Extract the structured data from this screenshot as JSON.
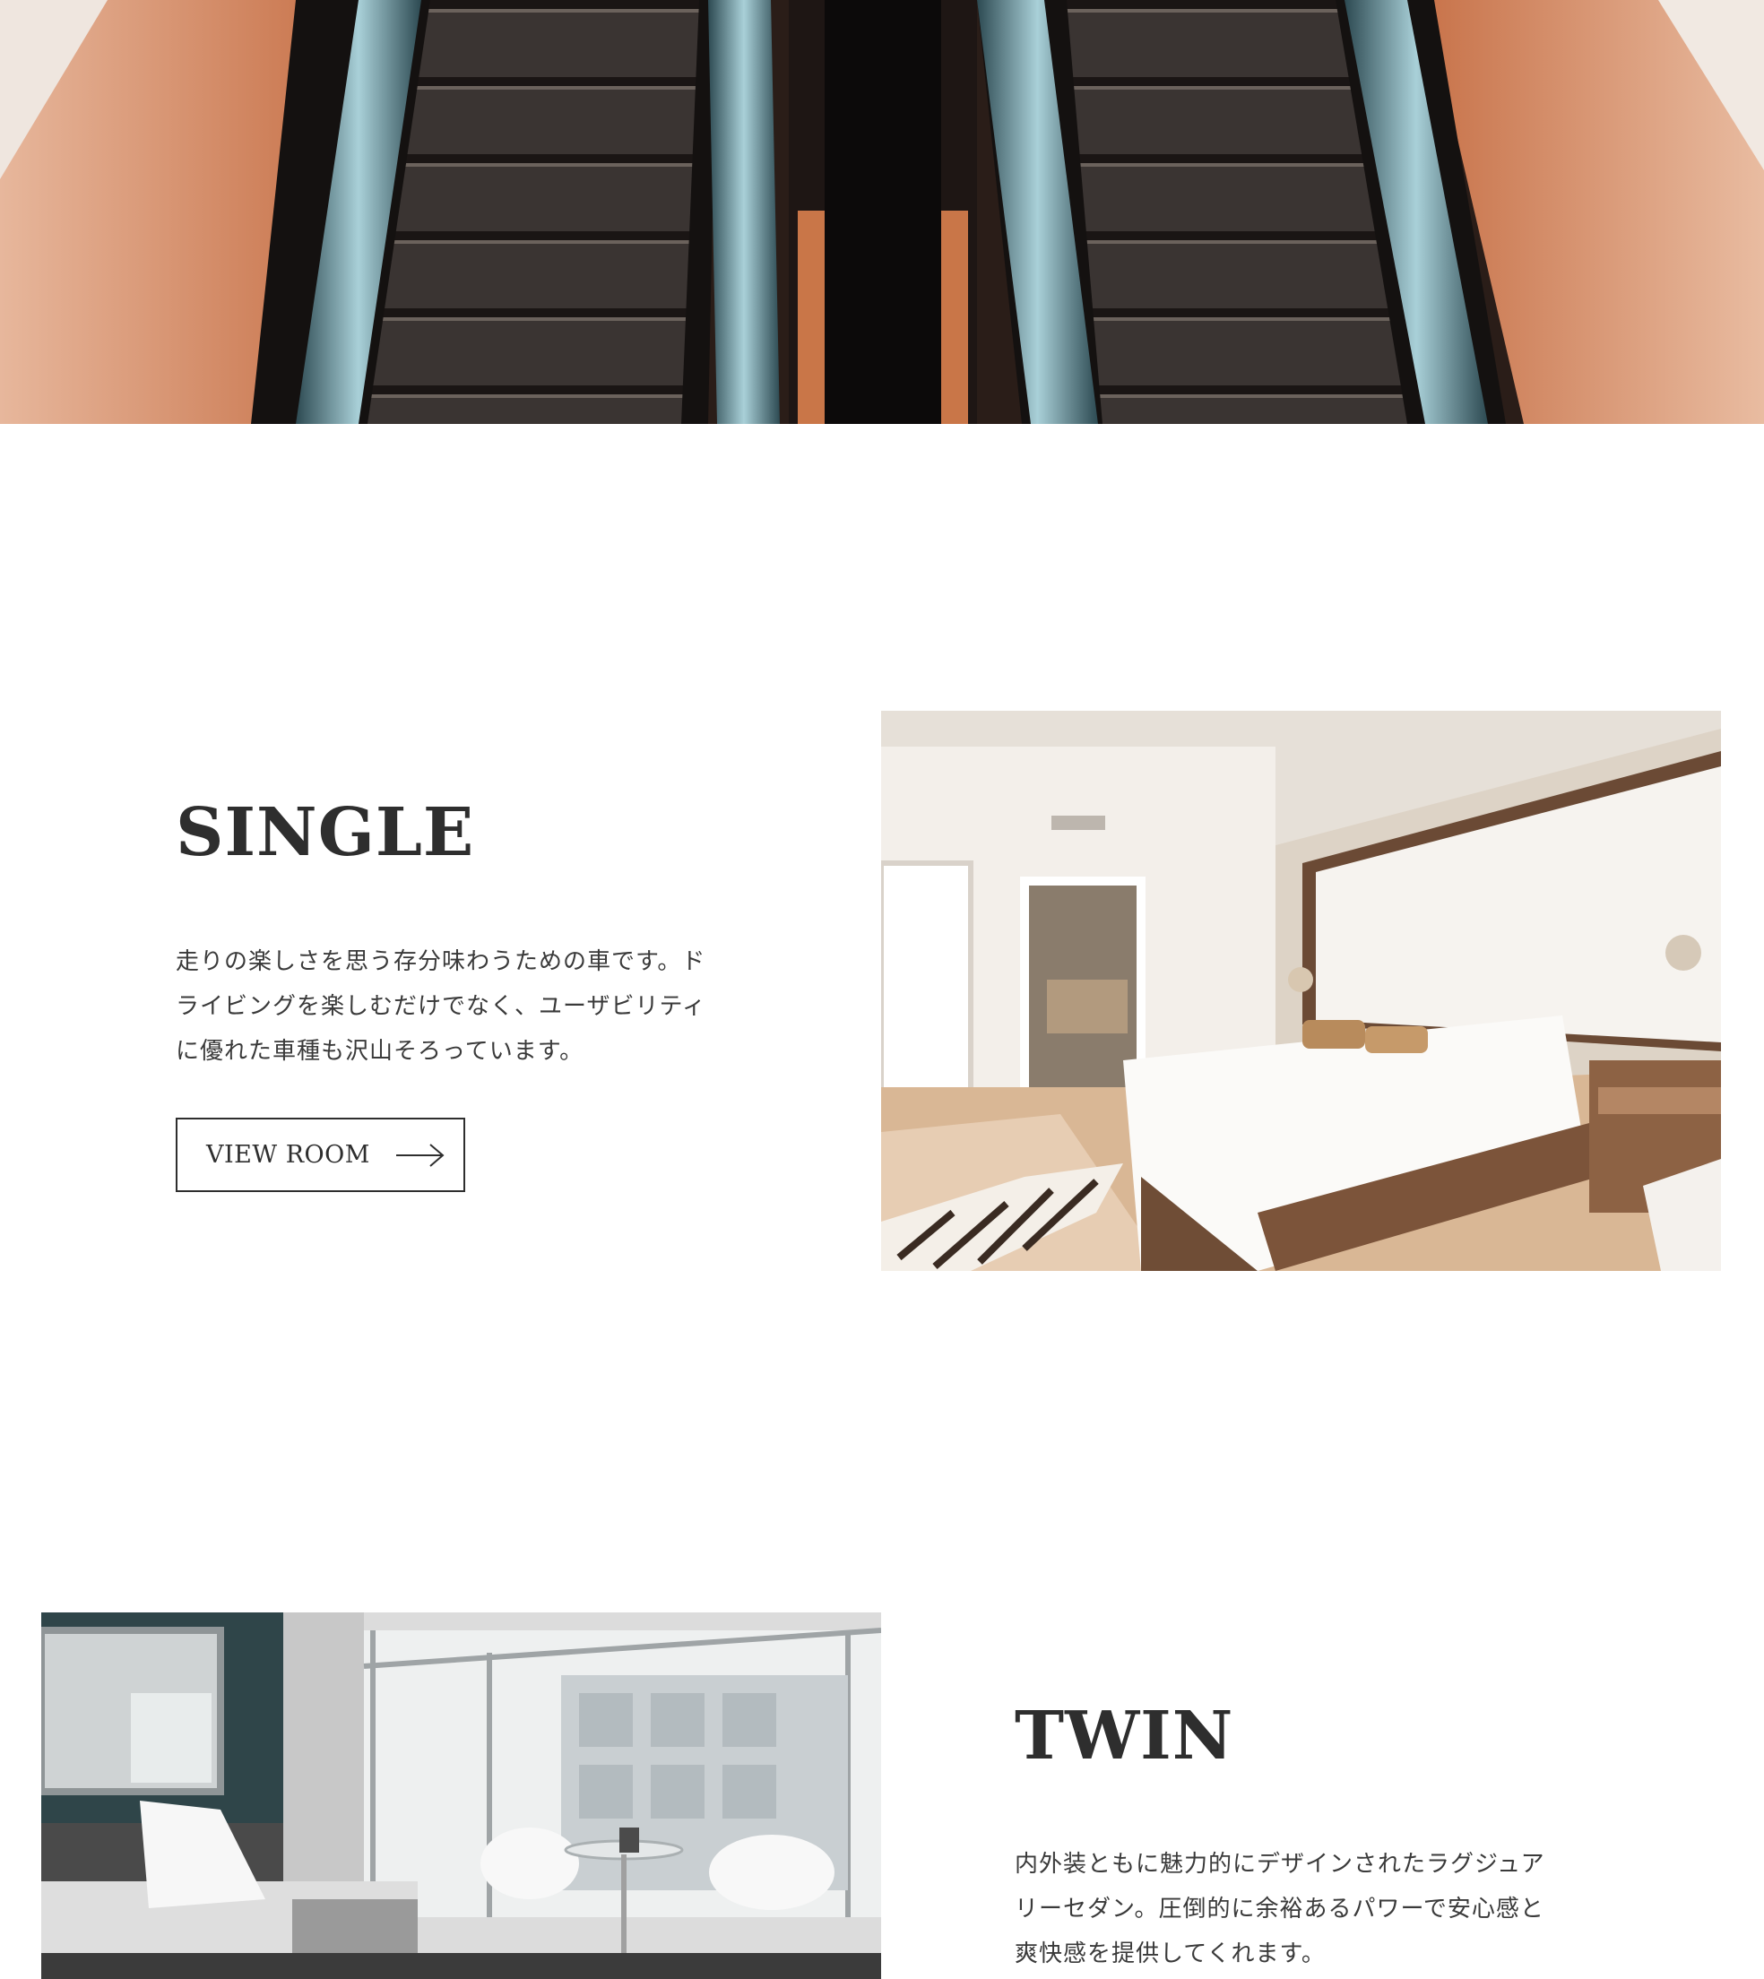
{
  "hero": {
    "image": "escalator-photo",
    "colors": {
      "warm": "#d48a63",
      "dark": "#1a1412",
      "rail": "#9fc4cc"
    }
  },
  "rooms": [
    {
      "title": "SINGLE",
      "description_lines": [
        "走りの楽しさを思う存分味わうための車です。ド",
        "ライビングを楽しむだけでなく、ユーザビリティ",
        "に優れた車種も沢山そろっています。"
      ],
      "button_label": "VIEW ROOM",
      "button_icon": "arrow-right-icon",
      "image": "bedroom-photo-warm"
    },
    {
      "title": "TWIN",
      "description_lines": [
        "内外装ともに魅力的にデザインされたラグジュア",
        "リーセダン。圧倒的に余裕あるパワーで安心感と",
        "爽快感を提供してくれます。"
      ],
      "image": "bedroom-photo-grey"
    }
  ]
}
